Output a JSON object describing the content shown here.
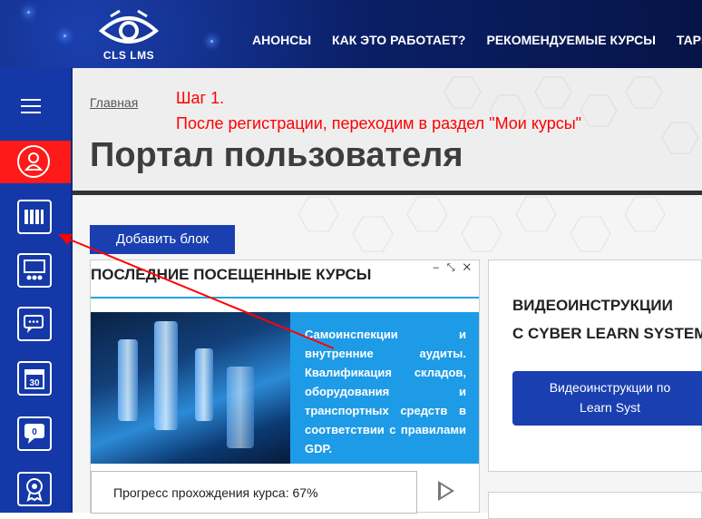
{
  "topbar": {
    "logo_text": "CLS LMS",
    "nav": [
      "АНОНСЫ",
      "КАК ЭТО РАБОТАЕТ?",
      "РЕКОМЕНДУЕМЫЕ КУРСЫ",
      "ТАРИФЫ"
    ]
  },
  "header": {
    "breadcrumb": "Главная",
    "title": "Портал пользователя"
  },
  "annotation": {
    "line1": "Шаг 1.",
    "line2": "После регистрации, переходим в раздел \"Мои курсы\""
  },
  "sidebar": {
    "items": [
      "menu-icon",
      "profile-icon",
      "my-courses-icon",
      "presentation-icon",
      "chat-icon",
      "calendar-icon",
      "messages-icon",
      "certificate-icon"
    ],
    "calendar_day": "30",
    "messages_count": "0",
    "active_color": "#ff1a1a"
  },
  "main": {
    "add_block_label": "Добавить блок",
    "recent": {
      "title": "ПОСЛЕДНИЕ ПОСЕЩЕННЫЕ КУРСЫ",
      "tools": "– ⤡ ✕",
      "course_description": "Самоинспекции и внутренние аудиты. Квалификация складов, оборудования и транспортных средств в соответствии с правилами GDP.",
      "progress_label": "Прогресс прохождения курса: 67%",
      "progress_value": 67
    },
    "video": {
      "title_line1": "ВИДЕОИНСТРУКЦИИ",
      "title_line2": "С CYBER LEARN SYSTEM",
      "button_line1": "Видеоинструкции по",
      "button_line2": "Learn Syst"
    }
  },
  "colors": {
    "brand": "#1a3fb0",
    "accent": "#1e9be6",
    "annotation": "#ff0000"
  }
}
